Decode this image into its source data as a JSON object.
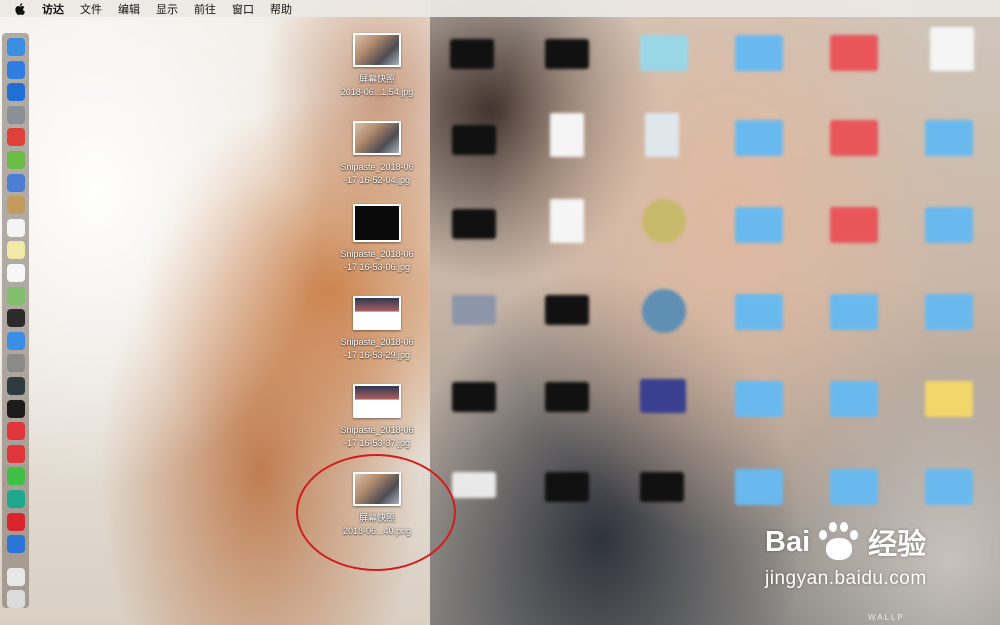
{
  "menubar": {
    "apple_icon": "apple-logo",
    "items": [
      "访达",
      "文件",
      "编辑",
      "显示",
      "前往",
      "窗口",
      "帮助"
    ]
  },
  "dock": {
    "icons": [
      {
        "name": "finder-icon",
        "color": "#3b8de0"
      },
      {
        "name": "download-icon",
        "color": "#2f7de0"
      },
      {
        "name": "safari-icon",
        "color": "#1f6fd6"
      },
      {
        "name": "launchpad-icon",
        "color": "#8b8f96"
      },
      {
        "name": "app-red-icon",
        "color": "#e0403a"
      },
      {
        "name": "android-icon",
        "color": "#6bbd45"
      },
      {
        "name": "preview-icon",
        "color": "#4c7fd3"
      },
      {
        "name": "notes-brown-icon",
        "color": "#c19a5c"
      },
      {
        "name": "calendar-icon",
        "color": "#f4f4f4"
      },
      {
        "name": "notes-icon",
        "color": "#f2e9a8"
      },
      {
        "name": "reminders-icon",
        "color": "#f7f7f7"
      },
      {
        "name": "maps-icon",
        "color": "#7fbf6b"
      },
      {
        "name": "terminal-green-icon",
        "color": "#2b2b2b"
      },
      {
        "name": "app-store-icon",
        "color": "#3a8ee6"
      },
      {
        "name": "system-preferences-icon",
        "color": "#8a8a8a"
      },
      {
        "name": "activity-monitor-icon",
        "color": "#2e3b3f"
      },
      {
        "name": "terminal-icon",
        "color": "#1b1b1b"
      },
      {
        "name": "vivaldi-icon",
        "color": "#e0353a"
      },
      {
        "name": "yandex-icon",
        "color": "#e0353a"
      },
      {
        "name": "wechat-icon",
        "color": "#3fbf45"
      },
      {
        "name": "app-teal-icon",
        "color": "#1ea88e"
      },
      {
        "name": "netease-music-icon",
        "color": "#d9252b"
      },
      {
        "name": "sogou-icon",
        "color": "#2a76d8"
      },
      {
        "name": "document-icon",
        "color": "#e8e8e8"
      },
      {
        "name": "trash-icon",
        "color": "#dcdcdc"
      }
    ]
  },
  "desktop_files": [
    {
      "line1": "屏幕快照",
      "line2": "2018-06...1.54.jpg",
      "thumb": "photo"
    },
    {
      "line1": "Snipaste_2018-06",
      "line2": "-17 16-52-04.jpg",
      "thumb": "photo"
    },
    {
      "line1": "Snipaste_2018-06",
      "line2": "-17 16-53-06.jpg",
      "thumb": "black"
    },
    {
      "line1": "Snipaste_2018-06",
      "line2": "-17 16-53-29.jpg",
      "thumb": "screen"
    },
    {
      "line1": "Snipaste_2018-06",
      "line2": "-17 16-53-37.jpg",
      "thumb": "screen"
    },
    {
      "line1": "屏幕快照",
      "line2": "2018-06...40.png",
      "thumb": "photo"
    }
  ],
  "watermark": {
    "brand_left": "Bai",
    "brand_right": "经验",
    "url": "jingyan.baidu.com",
    "small": "WALLP"
  },
  "annotation_color": "#d11d1d"
}
